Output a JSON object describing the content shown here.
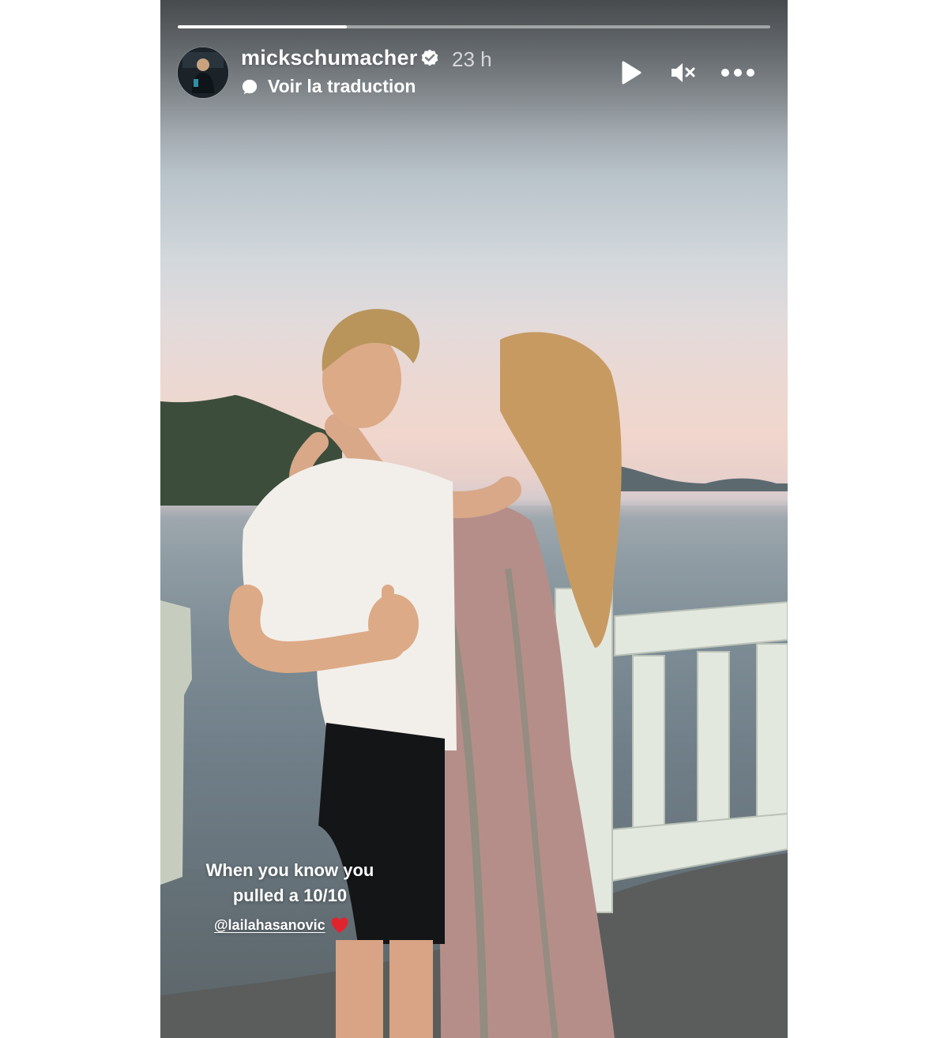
{
  "story": {
    "username": "mickschumacher",
    "time": "23 h",
    "translate_label": "Voir la traduction",
    "progress": 0.285,
    "verified": true,
    "controls": [
      {
        "name": "play",
        "icon": "play-icon"
      },
      {
        "name": "mute",
        "icon": "speaker-muted-icon"
      },
      {
        "name": "more",
        "icon": "more-dots-icon"
      }
    ],
    "caption_line1": "When you know you",
    "caption_line2": "pulled a 10/10",
    "mention": "@lailahasanovic",
    "mention_emoji": "heart-icon",
    "colors": {
      "heart": "#e0242f",
      "text": "#ffffff"
    }
  }
}
